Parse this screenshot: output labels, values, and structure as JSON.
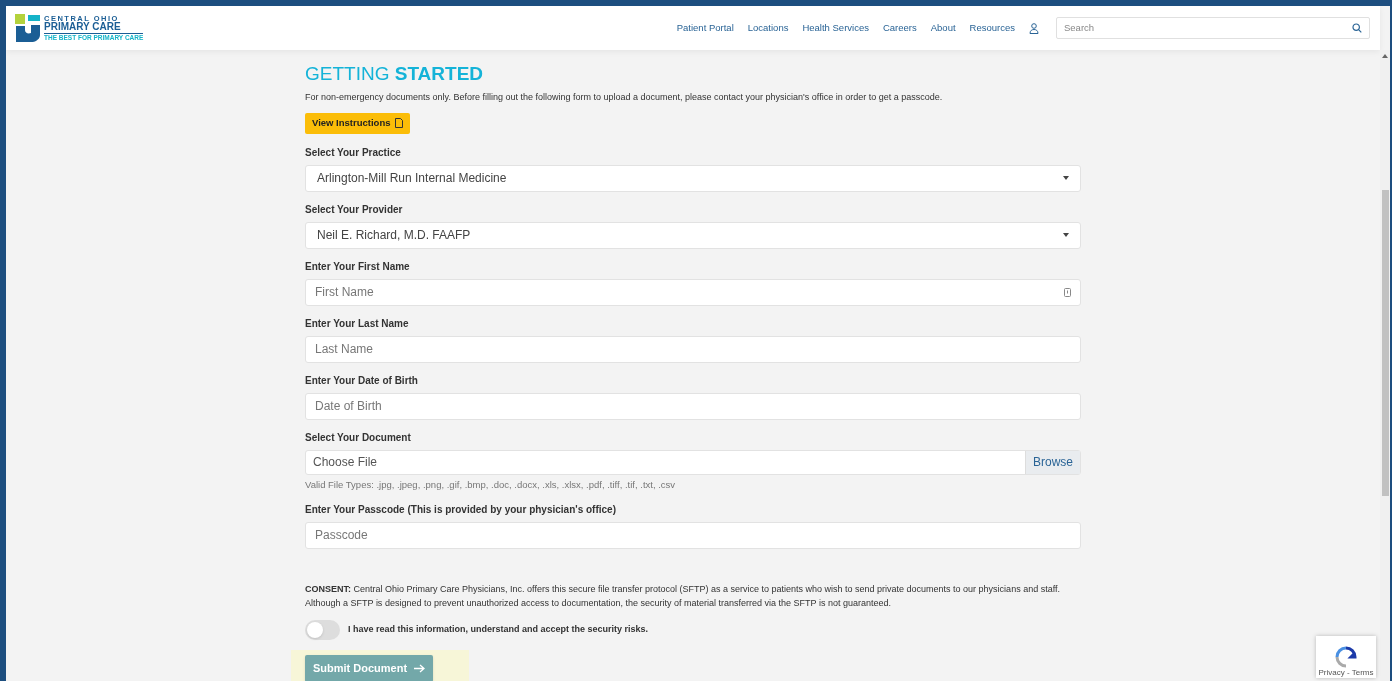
{
  "logo": {
    "line1": "CENTRAL OHIO",
    "line2": "PRIMARY CARE",
    "tagline": "THE BEST FOR PRIMARY CARE"
  },
  "nav": [
    "Patient Portal",
    "Locations",
    "Health Services",
    "Careers",
    "About",
    "Resources"
  ],
  "search": {
    "placeholder": "Search"
  },
  "heading": {
    "light": "GETTING",
    "bold": "STARTED"
  },
  "intro": "For non-emergency documents only. Before filling out the following form to upload a document, please contact your physician's office in order to get a passcode.",
  "instructions_button": "View Instructions",
  "fields": [
    {
      "kind": "select",
      "label": "Select Your Practice",
      "value": "Arlington-Mill Run Internal Medicine"
    },
    {
      "kind": "select",
      "label": "Select Your Provider",
      "value": "Neil E. Richard, M.D. FAAFP"
    },
    {
      "kind": "text",
      "label": "Enter Your First Name",
      "placeholder": "First Name",
      "autofill_icon": true
    },
    {
      "kind": "text",
      "label": "Enter Your Last Name",
      "placeholder": "Last Name"
    },
    {
      "kind": "text",
      "label": "Enter Your Date of Birth",
      "placeholder": "Date of Birth"
    },
    {
      "kind": "file",
      "label": "Select Your Document",
      "placeholder": "Choose File",
      "button": "Browse",
      "hint": "Valid File Types: .jpg, .jpeg, .png, .gif, .bmp, .doc, .docx, .xls, .xlsx, .pdf, .tiff, .tif, .txt, .csv"
    },
    {
      "kind": "text",
      "label": "Enter Your Passcode (This is provided by your physician's office)",
      "placeholder": "Passcode"
    }
  ],
  "consent": "**CONSENT:** Central Ohio Primary Care Physicians, Inc. offers this secure file transfer protocol (SFTP) as a service to patients who wish to send private documents to our physicians and staff. Although a SFTP is designed to prevent unauthorized access to documentation, the security of material transferred via the SFTP is not guaranteed.",
  "agree": {
    "label": "I have read this information, understand and accept the security risks.",
    "on": false
  },
  "submit": {
    "label": "Submit Document",
    "disabled": true
  },
  "recaptcha": {
    "text": "Privacy - Terms"
  }
}
